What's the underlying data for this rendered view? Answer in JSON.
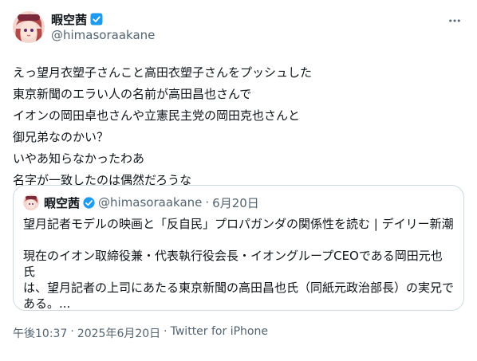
{
  "author": {
    "display_name": "暇空茜",
    "handle": "@himasoraakane"
  },
  "more_icon": "more-horizontal-icon",
  "verified_icon": "verified-badge-icon",
  "tweet": {
    "lines": "えっ望月衣塑子さんこと高田衣塑子さんをプッシュした\n東京新聞のエラい人の名前が高田昌也さんで\nイオンの岡田卓也さんや立憲民主党の岡田克也さんと\n御兄弟なのかい？\nいやあ知らなかったわあ\n名字が一致したのは偶然だろうな"
  },
  "quote": {
    "display_name": "暇空茜",
    "handle": "@himasoraakane",
    "separator": "·",
    "date": "6月20日",
    "title": "望月記者モデルの映画と「反自民」プロパガンダの関係性を読む | デイリー新潮",
    "excerpt": "現在のイオン取締役兼・代表執行役会長・イオングループCEOである岡田元也氏\nは、望月記者の上司にあたる東京新聞の高田昌也氏（同紙元政治部長）の実兄で\nある。..."
  },
  "meta": {
    "time": "午後10:37",
    "dot": "·",
    "date": "2025年6月20日",
    "dot2": "·",
    "source": "Twitter for iPhone"
  },
  "colors": {
    "text": "#0f1419",
    "secondary": "#536471",
    "border": "#cfd9de",
    "verified": "#1d9bf0"
  }
}
